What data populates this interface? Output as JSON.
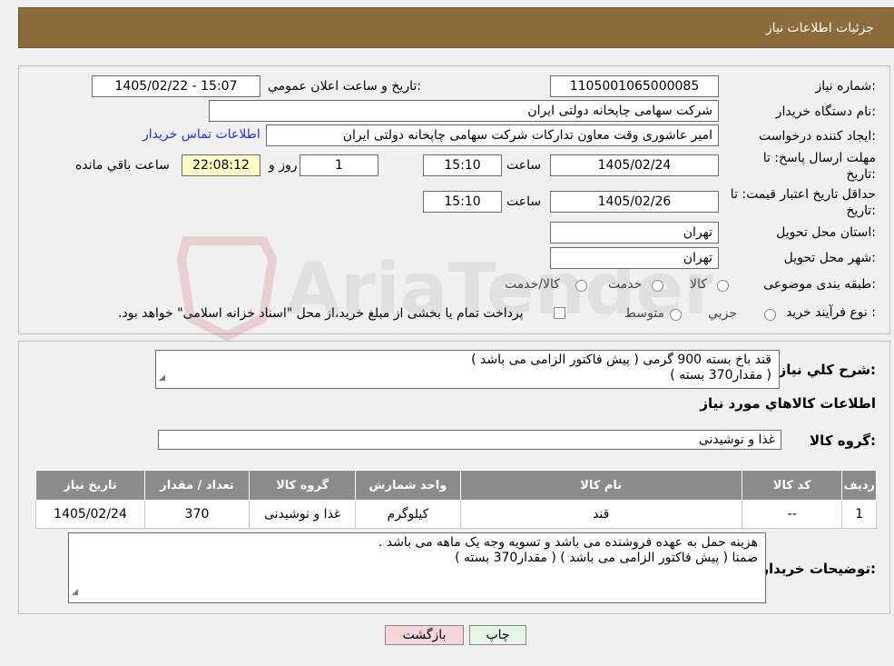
{
  "header": {
    "title": "جزئیات اطلاعات نیاز"
  },
  "need": {
    "number_label": "شماره نیاز:",
    "number": "1105001065000085",
    "announce_label": "تاریخ و ساعت اعلان عمومي:",
    "announce": "1405/02/22 - 15:07",
    "buyer_label": "نام دستگاه خريدار:",
    "buyer": "شرکت سهامی چاپخانه دولتی ایران",
    "creator_label": "ايجاد كننده درخواست:",
    "creator": "امیر عاشوری وقت معاون تدارکات شرکت سهامی چاپخانه دولتی ایران",
    "contact_link": "اطلاعات تماس خريدار",
    "deadline_label_1": "مهلت ارسال پاسخ: تا",
    "deadline_label_2": "تاريخ:",
    "deadline_date": "1405/02/24",
    "time_word": "ساعت",
    "deadline_time": "15:10",
    "days": "1",
    "days_word": "روز و",
    "remaining": "22:08:12",
    "remaining_word": "ساعت باقي مانده",
    "validity_label_1": "حداقل تاريخ اعتبار قيمت: تا",
    "validity_label_2": "تاريخ:",
    "validity_date": "1405/02/26",
    "validity_time": "15:10",
    "province_label": "استان محل تحويل:",
    "province": "تهران",
    "city_label": "شهر محل تحويل:",
    "city": "تهران",
    "category_label": "طبقه بندی موضوعی:",
    "category_options": [
      "كالا",
      "خدمت",
      "كالا/خدمت"
    ],
    "process_label": "نوع فرآيند خريد :",
    "process_options": [
      "جزيي",
      "متوسط"
    ],
    "process_note": "پرداخت تمام یا بخشی از مبلغ خرید،از محل \"اسناد خزانه اسلامی\" خواهد بود."
  },
  "description": {
    "label": "شرح كلي نياز:",
    "line1": "قند باخ بسته 900 گرمی ( پیش فاکتور الزامی می باشد )",
    "line2": "( مقدار370 بسته )"
  },
  "goods": {
    "title": "اطلاعات كالاهاي مورد نياز",
    "group_label": "گروه كالا:",
    "group_value": "غذا و نوشیدنی"
  },
  "table": {
    "headers": [
      "رديف",
      "كد كالا",
      "نام كالا",
      "واحد شمارش",
      "گروه كالا",
      "تعداد / مقدار",
      "تاريخ نياز"
    ],
    "rows": [
      [
        "1",
        "--",
        "قند",
        "کیلوگرم",
        "غذا و نوشیدنی",
        "370",
        "1405/02/24"
      ]
    ]
  },
  "buyer_notes": {
    "label": "توضيحات خريدار:",
    "line1": "هزینه حمل به عهده فروشنده می باشد و تسویه وجه یک ماهه می باشد .",
    "line2": "ضمنا  ( پیش فاکتور الزامی می باشد ) ( مقدار370 بسته )"
  },
  "buttons": {
    "print": "چاپ",
    "back": "بازگشت"
  },
  "watermark": {
    "text": "AriaTender.neT"
  },
  "colors": {
    "header": "#8b6a3b",
    "table_header": "#8b8b8b",
    "remaining_bg": "#ffffc8",
    "back_btn": "#f6d6d6",
    "print_btn": "#e6f6e6"
  }
}
